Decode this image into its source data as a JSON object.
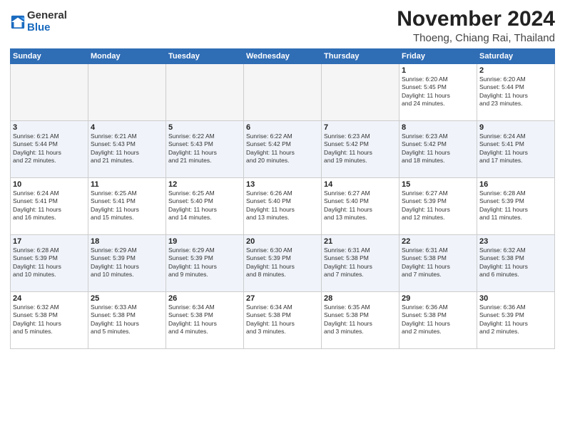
{
  "logo": {
    "general": "General",
    "blue": "Blue"
  },
  "title": "November 2024",
  "location": "Thoeng, Chiang Rai, Thailand",
  "days_of_week": [
    "Sunday",
    "Monday",
    "Tuesday",
    "Wednesday",
    "Thursday",
    "Friday",
    "Saturday"
  ],
  "weeks": [
    [
      {
        "day": "",
        "detail": ""
      },
      {
        "day": "",
        "detail": ""
      },
      {
        "day": "",
        "detail": ""
      },
      {
        "day": "",
        "detail": ""
      },
      {
        "day": "",
        "detail": ""
      },
      {
        "day": "1",
        "detail": "Sunrise: 6:20 AM\nSunset: 5:45 PM\nDaylight: 11 hours\nand 24 minutes."
      },
      {
        "day": "2",
        "detail": "Sunrise: 6:20 AM\nSunset: 5:44 PM\nDaylight: 11 hours\nand 23 minutes."
      }
    ],
    [
      {
        "day": "3",
        "detail": "Sunrise: 6:21 AM\nSunset: 5:44 PM\nDaylight: 11 hours\nand 22 minutes."
      },
      {
        "day": "4",
        "detail": "Sunrise: 6:21 AM\nSunset: 5:43 PM\nDaylight: 11 hours\nand 21 minutes."
      },
      {
        "day": "5",
        "detail": "Sunrise: 6:22 AM\nSunset: 5:43 PM\nDaylight: 11 hours\nand 21 minutes."
      },
      {
        "day": "6",
        "detail": "Sunrise: 6:22 AM\nSunset: 5:42 PM\nDaylight: 11 hours\nand 20 minutes."
      },
      {
        "day": "7",
        "detail": "Sunrise: 6:23 AM\nSunset: 5:42 PM\nDaylight: 11 hours\nand 19 minutes."
      },
      {
        "day": "8",
        "detail": "Sunrise: 6:23 AM\nSunset: 5:42 PM\nDaylight: 11 hours\nand 18 minutes."
      },
      {
        "day": "9",
        "detail": "Sunrise: 6:24 AM\nSunset: 5:41 PM\nDaylight: 11 hours\nand 17 minutes."
      }
    ],
    [
      {
        "day": "10",
        "detail": "Sunrise: 6:24 AM\nSunset: 5:41 PM\nDaylight: 11 hours\nand 16 minutes."
      },
      {
        "day": "11",
        "detail": "Sunrise: 6:25 AM\nSunset: 5:41 PM\nDaylight: 11 hours\nand 15 minutes."
      },
      {
        "day": "12",
        "detail": "Sunrise: 6:25 AM\nSunset: 5:40 PM\nDaylight: 11 hours\nand 14 minutes."
      },
      {
        "day": "13",
        "detail": "Sunrise: 6:26 AM\nSunset: 5:40 PM\nDaylight: 11 hours\nand 13 minutes."
      },
      {
        "day": "14",
        "detail": "Sunrise: 6:27 AM\nSunset: 5:40 PM\nDaylight: 11 hours\nand 13 minutes."
      },
      {
        "day": "15",
        "detail": "Sunrise: 6:27 AM\nSunset: 5:39 PM\nDaylight: 11 hours\nand 12 minutes."
      },
      {
        "day": "16",
        "detail": "Sunrise: 6:28 AM\nSunset: 5:39 PM\nDaylight: 11 hours\nand 11 minutes."
      }
    ],
    [
      {
        "day": "17",
        "detail": "Sunrise: 6:28 AM\nSunset: 5:39 PM\nDaylight: 11 hours\nand 10 minutes."
      },
      {
        "day": "18",
        "detail": "Sunrise: 6:29 AM\nSunset: 5:39 PM\nDaylight: 11 hours\nand 10 minutes."
      },
      {
        "day": "19",
        "detail": "Sunrise: 6:29 AM\nSunset: 5:39 PM\nDaylight: 11 hours\nand 9 minutes."
      },
      {
        "day": "20",
        "detail": "Sunrise: 6:30 AM\nSunset: 5:39 PM\nDaylight: 11 hours\nand 8 minutes."
      },
      {
        "day": "21",
        "detail": "Sunrise: 6:31 AM\nSunset: 5:38 PM\nDaylight: 11 hours\nand 7 minutes."
      },
      {
        "day": "22",
        "detail": "Sunrise: 6:31 AM\nSunset: 5:38 PM\nDaylight: 11 hours\nand 7 minutes."
      },
      {
        "day": "23",
        "detail": "Sunrise: 6:32 AM\nSunset: 5:38 PM\nDaylight: 11 hours\nand 6 minutes."
      }
    ],
    [
      {
        "day": "24",
        "detail": "Sunrise: 6:32 AM\nSunset: 5:38 PM\nDaylight: 11 hours\nand 5 minutes."
      },
      {
        "day": "25",
        "detail": "Sunrise: 6:33 AM\nSunset: 5:38 PM\nDaylight: 11 hours\nand 5 minutes."
      },
      {
        "day": "26",
        "detail": "Sunrise: 6:34 AM\nSunset: 5:38 PM\nDaylight: 11 hours\nand 4 minutes."
      },
      {
        "day": "27",
        "detail": "Sunrise: 6:34 AM\nSunset: 5:38 PM\nDaylight: 11 hours\nand 3 minutes."
      },
      {
        "day": "28",
        "detail": "Sunrise: 6:35 AM\nSunset: 5:38 PM\nDaylight: 11 hours\nand 3 minutes."
      },
      {
        "day": "29",
        "detail": "Sunrise: 6:36 AM\nSunset: 5:38 PM\nDaylight: 11 hours\nand 2 minutes."
      },
      {
        "day": "30",
        "detail": "Sunrise: 6:36 AM\nSunset: 5:39 PM\nDaylight: 11 hours\nand 2 minutes."
      }
    ]
  ]
}
